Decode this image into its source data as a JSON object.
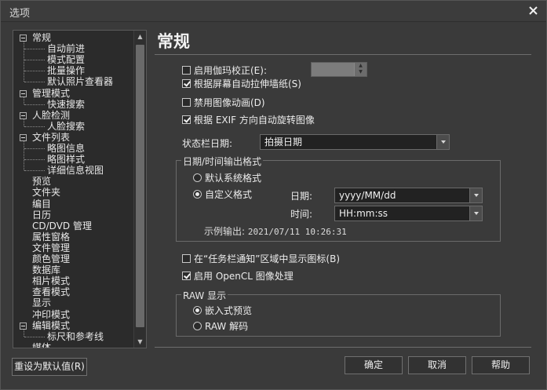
{
  "window": {
    "title": "选项",
    "close_glyph": "×"
  },
  "tree": {
    "items": [
      {
        "label": "常规",
        "toggle": true
      },
      {
        "label": "自动前进"
      },
      {
        "label": "模式配置"
      },
      {
        "label": "批量操作"
      },
      {
        "label": "默认照片查看器"
      },
      {
        "label": "管理模式",
        "toggle": true
      },
      {
        "label": "快速搜索"
      },
      {
        "label": "人脸检测",
        "toggle": true
      },
      {
        "label": "人脸搜索"
      },
      {
        "label": "文件列表",
        "toggle": true
      },
      {
        "label": "略图信息"
      },
      {
        "label": "略图样式"
      },
      {
        "label": "详细信息视图"
      },
      {
        "label": "预览"
      },
      {
        "label": "文件夹"
      },
      {
        "label": "编目"
      },
      {
        "label": "日历"
      },
      {
        "label": "CD/DVD 管理"
      },
      {
        "label": "属性窗格"
      },
      {
        "label": "文件管理"
      },
      {
        "label": "颜色管理"
      },
      {
        "label": "数据库"
      },
      {
        "label": "相片模式"
      },
      {
        "label": "查看模式"
      },
      {
        "label": "显示"
      },
      {
        "label": "冲印模式"
      },
      {
        "label": "编辑模式",
        "toggle": true
      },
      {
        "label": "标尺和参考线"
      },
      {
        "label": "媒体"
      }
    ]
  },
  "main": {
    "heading": "常规",
    "gamma_label": "启用伽玛校正(E):",
    "gamma_checked": false,
    "stretch_wallpaper_label": "根据屏幕自动拉伸墙纸(S)",
    "stretch_wallpaper_checked": true,
    "disable_animation_label": "禁用图像动画(D)",
    "disable_animation_checked": false,
    "exif_rotate_label": "根据 EXIF 方向自动旋转图像",
    "exif_rotate_checked": true,
    "statusbar_date_label": "状态栏日期:",
    "statusbar_date_value": "拍摄日期",
    "datetime_group": {
      "title": "日期/时间输出格式",
      "default_format_label": "默认系统格式",
      "custom_format_label": "自定义格式",
      "selected": "custom",
      "date_label": "日期:",
      "date_value": "yyyy/MM/dd",
      "time_label": "时间:",
      "time_value": "HH:mm:ss",
      "sample_label": "示例输出:",
      "sample_value": "2021/07/11 10:26:31"
    },
    "taskbar_icon_label": "在“任务栏通知”区域中显示图标(B)",
    "taskbar_icon_checked": false,
    "opencl_label": "启用 OpenCL 图像处理",
    "opencl_checked": true,
    "raw_group": {
      "title": "RAW 显示",
      "embedded_label": "嵌入式预览",
      "decode_label": "RAW 解码",
      "selected": "embedded"
    }
  },
  "footer": {
    "reset_label": "重设为默认值(R)",
    "ok_label": "确定",
    "cancel_label": "取消",
    "help_label": "帮助"
  },
  "icons": {
    "close": "close-icon",
    "tree_toggle": "minus-box-icon",
    "dropdown": "chevron-down-icon"
  }
}
